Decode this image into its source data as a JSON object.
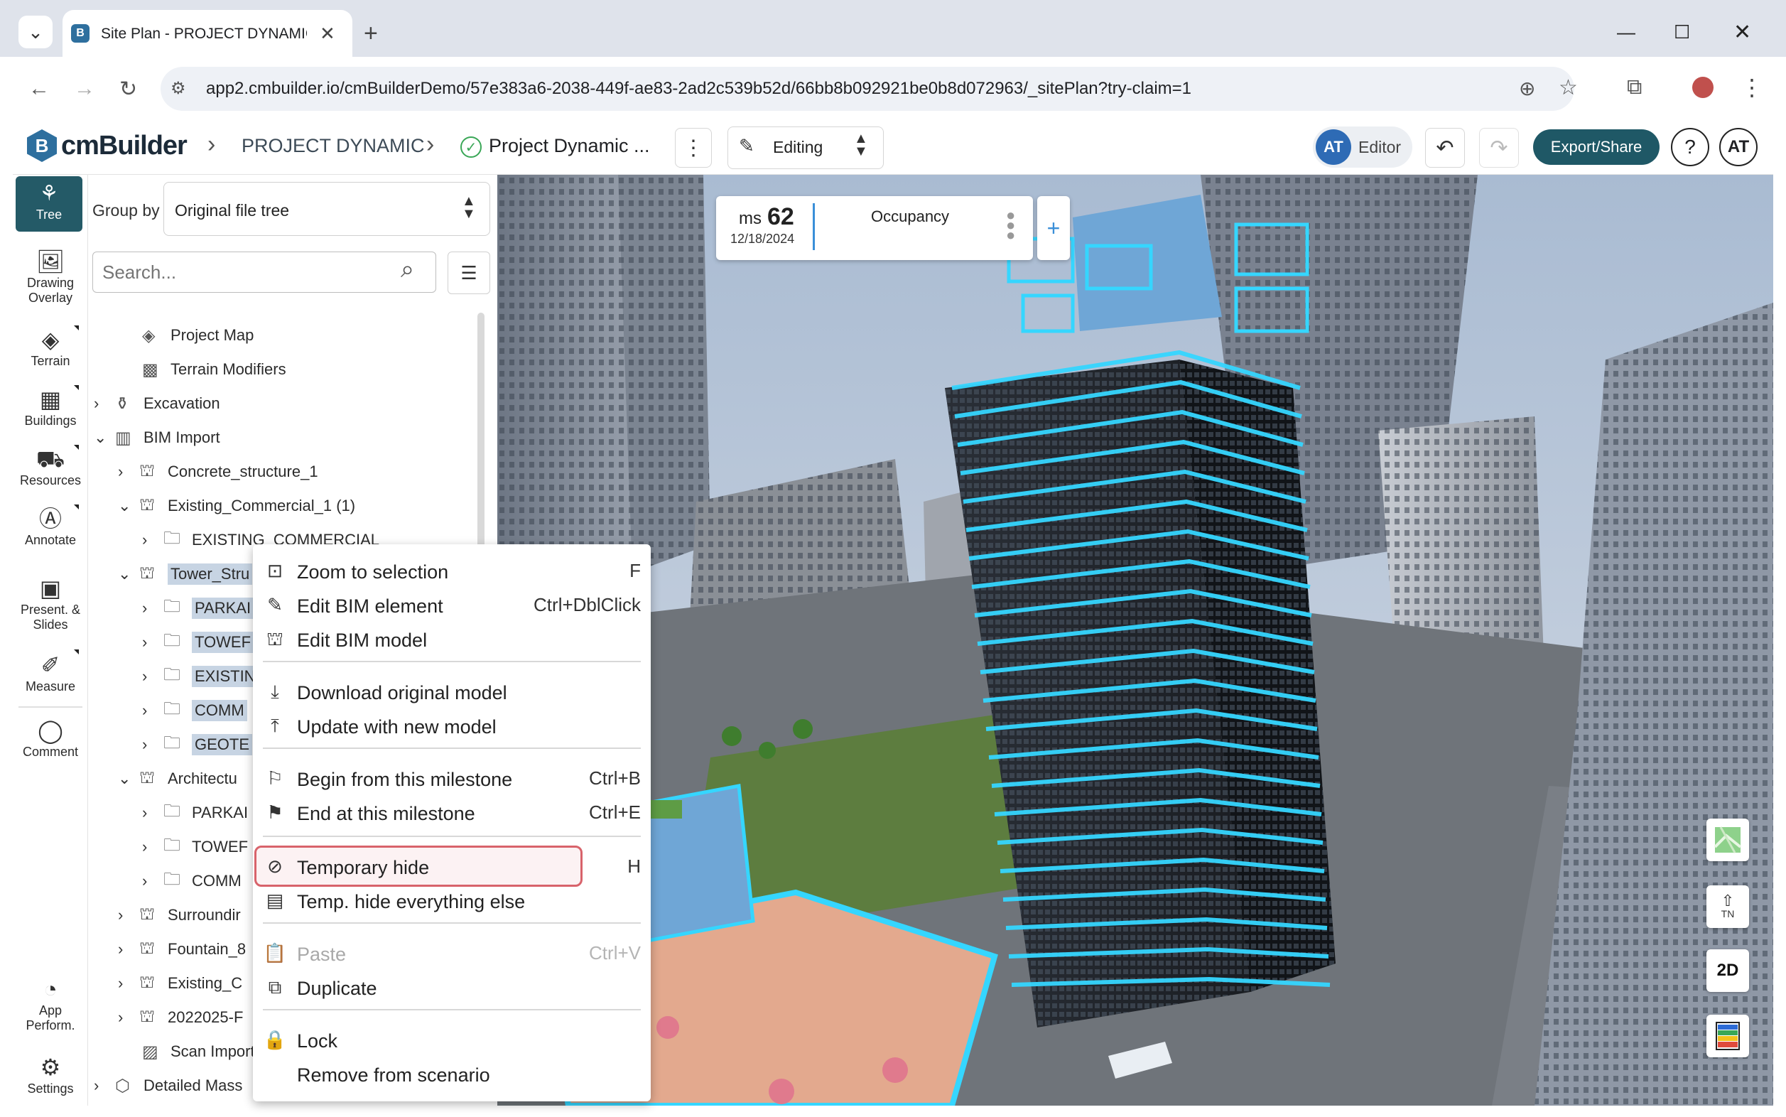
{
  "browser": {
    "tab_title": "Site Plan - PROJECT DYNAMIC |",
    "url": "app2.cmbuilder.io/cmBuilderDemo/57e383a6-2038-449f-ae83-2ad2c539b52d/66bb8b092921be0b8d072963/_sitePlan?try-claim=1"
  },
  "header": {
    "logo_text": "cmBuilder",
    "logo_mark": "B",
    "project": "PROJECT DYNAMIC",
    "plan": "Project Dynamic ...",
    "mode": "Editing",
    "role_initials": "AT",
    "role": "Editor",
    "export_label": "Export/Share",
    "help_label": "?",
    "user_initials": "AT"
  },
  "rail": [
    {
      "label": "Tree",
      "icon": "tree-icon"
    },
    {
      "label": "Drawing Overlay",
      "icon": "image-icon"
    },
    {
      "label": "Terrain",
      "icon": "terrain-icon"
    },
    {
      "label": "Buildings",
      "icon": "buildings-icon"
    },
    {
      "label": "Resources",
      "icon": "resources-icon"
    },
    {
      "label": "Annotate",
      "icon": "annotate-icon"
    },
    {
      "label": "Present. & Slides",
      "icon": "present-icon"
    },
    {
      "label": "Measure",
      "icon": "ruler-icon"
    },
    {
      "label": "Comment",
      "icon": "comment-icon"
    },
    {
      "label": "App Perform.",
      "icon": "gauge-icon"
    },
    {
      "label": "Settings",
      "icon": "gear-icon"
    }
  ],
  "panel": {
    "group_by_label": "Group by",
    "group_by_value": "Original file tree",
    "search_placeholder": "Search..."
  },
  "tree": [
    {
      "label": "Project Map",
      "chevron": "",
      "icon": "map-icon"
    },
    {
      "label": "Terrain Modifiers",
      "chevron": "",
      "icon": "terrain-modifier-icon"
    },
    {
      "label": "Excavation",
      "chevron": ">",
      "icon": "excavation-icon"
    },
    {
      "label": "BIM Import",
      "chevron": "v",
      "icon": "bim-icon"
    },
    {
      "label": "Concrete_structure_1",
      "chevron": ">",
      "icon": "model-icon"
    },
    {
      "label": "Existing_Commercial_1 (1)",
      "chevron": "v",
      "icon": "model-icon"
    },
    {
      "label": "EXISTING_COMMERCIAL",
      "chevron": ">",
      "icon": "folder-icon"
    },
    {
      "label": "Tower_Stru",
      "chevron": "v",
      "icon": "model-icon"
    },
    {
      "label": "PARKAI",
      "chevron": ">",
      "icon": "folder-icon"
    },
    {
      "label": "TOWEF",
      "chevron": ">",
      "icon": "folder-icon"
    },
    {
      "label": "EXISTIN",
      "chevron": ">",
      "icon": "folder-icon"
    },
    {
      "label": "COMM",
      "chevron": ">",
      "icon": "folder-icon"
    },
    {
      "label": "GEOTE",
      "chevron": ">",
      "icon": "folder-icon"
    },
    {
      "label": "Architectu",
      "chevron": "v",
      "icon": "model-icon"
    },
    {
      "label": "PARKAI",
      "chevron": ">",
      "icon": "folder-icon"
    },
    {
      "label": "TOWEF",
      "chevron": ">",
      "icon": "folder-icon"
    },
    {
      "label": "COMM",
      "chevron": ">",
      "icon": "folder-icon"
    },
    {
      "label": "Surroundir",
      "chevron": ">",
      "icon": "model-icon"
    },
    {
      "label": "Fountain_8",
      "chevron": ">",
      "icon": "model-icon"
    },
    {
      "label": "Existing_C",
      "chevron": ">",
      "icon": "model-icon"
    },
    {
      "label": "2022025-F",
      "chevron": ">",
      "icon": "model-icon"
    },
    {
      "label": "Scan Import",
      "chevron": "",
      "icon": "scan-icon"
    },
    {
      "label": "Detailed Mass",
      "chevron": ">",
      "icon": "mass-icon"
    }
  ],
  "milestone": {
    "prefix": "ms",
    "number": "62",
    "date": "12/18/2024",
    "phase": "Occupancy",
    "add_label": "+"
  },
  "context_menu": [
    {
      "label": "Zoom to selection",
      "shortcut": "F",
      "icon": "zoom-selection-icon"
    },
    {
      "label": "Edit BIM element",
      "shortcut": "Ctrl+DblClick",
      "icon": "pencil-icon"
    },
    {
      "label": "Edit BIM model",
      "shortcut": "",
      "icon": "edit-model-icon"
    },
    {
      "label": "Download original model",
      "shortcut": "",
      "icon": "download-icon"
    },
    {
      "label": "Update with new model",
      "shortcut": "",
      "icon": "upload-icon"
    },
    {
      "label": "Begin from this milestone",
      "shortcut": "Ctrl+B",
      "icon": "flag-icon"
    },
    {
      "label": "End at this milestone",
      "shortcut": "Ctrl+E",
      "icon": "checkered-flag-icon"
    },
    {
      "label": "Temporary hide",
      "shortcut": "H",
      "icon": "eye-off-icon"
    },
    {
      "label": "Temp. hide everything else",
      "shortcut": "",
      "icon": "hide-others-icon"
    },
    {
      "label": "Paste",
      "shortcut": "Ctrl+V",
      "icon": "clipboard-icon"
    },
    {
      "label": "Duplicate",
      "shortcut": "",
      "icon": "duplicate-icon"
    },
    {
      "label": "Lock",
      "shortcut": "",
      "icon": "lock-icon"
    },
    {
      "label": "Remove from scenario",
      "shortcut": "",
      "icon": ""
    }
  ],
  "viewport_tools": {
    "north_label": "TN",
    "view_2d_label": "2D"
  },
  "colors": {
    "accent": "#245a67",
    "export_bg": "#1f5866",
    "highlight_border": "#d8636b",
    "selection_cyan": "#35d6ff"
  }
}
